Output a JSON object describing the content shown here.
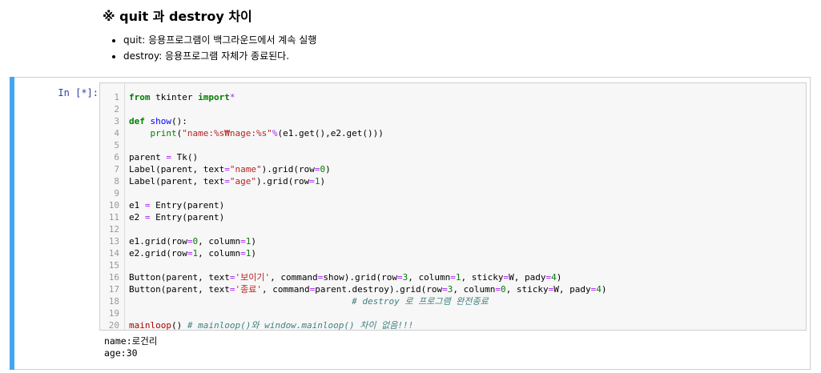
{
  "markdown": {
    "heading": "※ quit 과 destroy 차이",
    "items": [
      "quit: 응용프로그램이 백그라운드에서 계속 실행",
      "destroy: 응용프로그램 자체가 종료된다."
    ]
  },
  "cell": {
    "prompt": "In [*]:",
    "line_numbers": [
      "1",
      "2",
      "3",
      "4",
      "5",
      "6",
      "7",
      "8",
      "9",
      "10",
      "11",
      "12",
      "13",
      "14",
      "15",
      "16",
      "17",
      "18",
      "19",
      "20"
    ],
    "output_lines": [
      "name:로건리",
      "age:30"
    ]
  },
  "colors": {
    "selected_bar": "#42a5f5",
    "prompt": "#303f9f",
    "keyword": "#008000",
    "string": "#ba2121",
    "comment": "#408080"
  }
}
